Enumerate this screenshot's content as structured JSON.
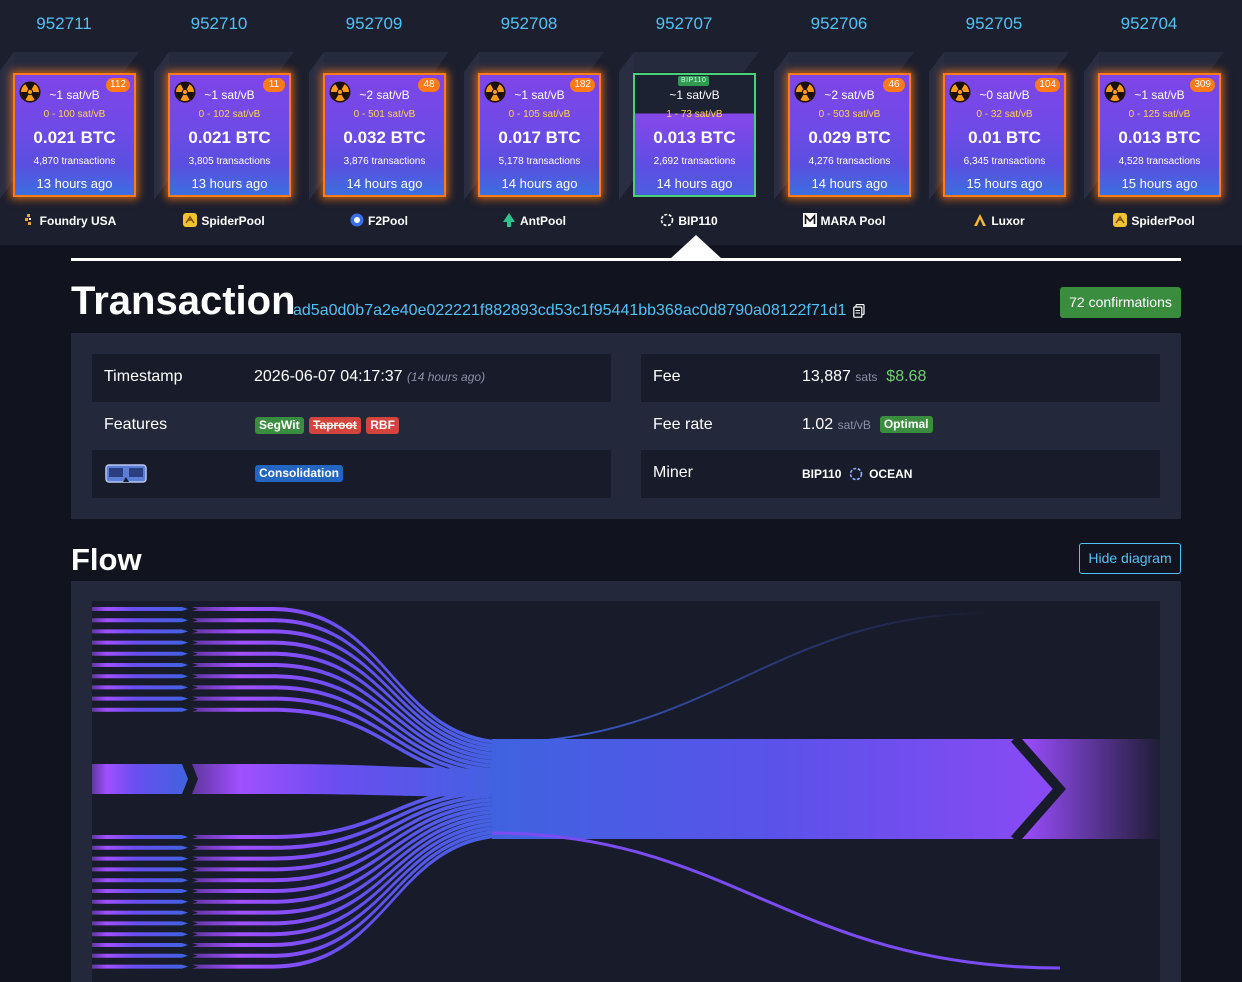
{
  "blocks": [
    {
      "height": "952711",
      "median_fee": "~1 sat/vB",
      "fee_range": "0 - 100 sat/vB",
      "total": "0.021 BTC",
      "tx_count": "4,870 transactions",
      "ago": "13 hours ago",
      "badge": "112",
      "pool": "Foundry USA",
      "pool_icon": "foundry-icon",
      "current": false
    },
    {
      "height": "952710",
      "median_fee": "~1 sat/vB",
      "fee_range": "0 - 102 sat/vB",
      "total": "0.021 BTC",
      "tx_count": "3,805 transactions",
      "ago": "13 hours ago",
      "badge": "11",
      "pool": "SpiderPool",
      "pool_icon": "spiderpool-icon",
      "current": false
    },
    {
      "height": "952709",
      "median_fee": "~2 sat/vB",
      "fee_range": "0 - 501 sat/vB",
      "total": "0.032 BTC",
      "tx_count": "3,876 transactions",
      "ago": "14 hours ago",
      "badge": "48",
      "pool": "F2Pool",
      "pool_icon": "f2pool-icon",
      "current": false
    },
    {
      "height": "952708",
      "median_fee": "~1 sat/vB",
      "fee_range": "0 - 105 sat/vB",
      "total": "0.017 BTC",
      "tx_count": "5,178 transactions",
      "ago": "14 hours ago",
      "badge": "182",
      "pool": "AntPool",
      "pool_icon": "antpool-icon",
      "current": false
    },
    {
      "height": "952707",
      "median_fee": "~1 sat/vB",
      "fee_range": "1 - 73 sat/vB",
      "total": "0.013 BTC",
      "tx_count": "2,692 transactions",
      "ago": "14 hours ago",
      "badge": "BIP110",
      "pool": "BIP110",
      "pool_icon": "ocean-icon",
      "current": true
    },
    {
      "height": "952706",
      "median_fee": "~2 sat/vB",
      "fee_range": "0 - 503 sat/vB",
      "total": "0.029 BTC",
      "tx_count": "4,276 transactions",
      "ago": "14 hours ago",
      "badge": "46",
      "pool": "MARA Pool",
      "pool_icon": "mara-icon",
      "current": false
    },
    {
      "height": "952705",
      "median_fee": "~0 sat/vB",
      "fee_range": "0 - 32 sat/vB",
      "total": "0.01 BTC",
      "tx_count": "6,345 transactions",
      "ago": "15 hours ago",
      "badge": "104",
      "pool": "Luxor",
      "pool_icon": "luxor-icon",
      "current": false
    },
    {
      "height": "952704",
      "median_fee": "~1 sat/vB",
      "fee_range": "0 - 125 sat/vB",
      "total": "0.013 BTC",
      "tx_count": "4,528 transactions",
      "ago": "15 hours ago",
      "badge": "309",
      "pool": "SpiderPool",
      "pool_icon": "spiderpool-icon",
      "current": false
    }
  ],
  "transaction": {
    "title": "Transaction",
    "txid": "ad5a0d0b7a2e40e022221f882893cd53c1f95441bb368ac0d8790a08122f71d1",
    "confirmations": "72 confirmations"
  },
  "details": {
    "timestamp_label": "Timestamp",
    "timestamp_value": "2026-06-07 04:17:37",
    "timestamp_relative": "(14 hours ago)",
    "features_label": "Features",
    "features": [
      "SegWit",
      "Taproot",
      "RBF"
    ],
    "tag": "Consolidation",
    "fee_label": "Fee",
    "fee_sats": "13,887",
    "fee_sats_unit": "sats",
    "fee_usd": "$8.68",
    "fee_rate_label": "Fee rate",
    "fee_rate": "1.02",
    "fee_rate_unit": "sat/vB",
    "fee_rate_badge": "Optimal",
    "miner_label": "Miner",
    "miner_name": "BIP110",
    "miner_pool": "OCEAN"
  },
  "flow": {
    "title": "Flow",
    "toggle_label": "Hide diagram"
  },
  "colors": {
    "accent": "#4fc3f7",
    "confirm_green": "#3a8d3e",
    "block_border": "#ff7a18",
    "flow_purple": "#9b4dff",
    "flow_blue": "#3f63e0"
  }
}
